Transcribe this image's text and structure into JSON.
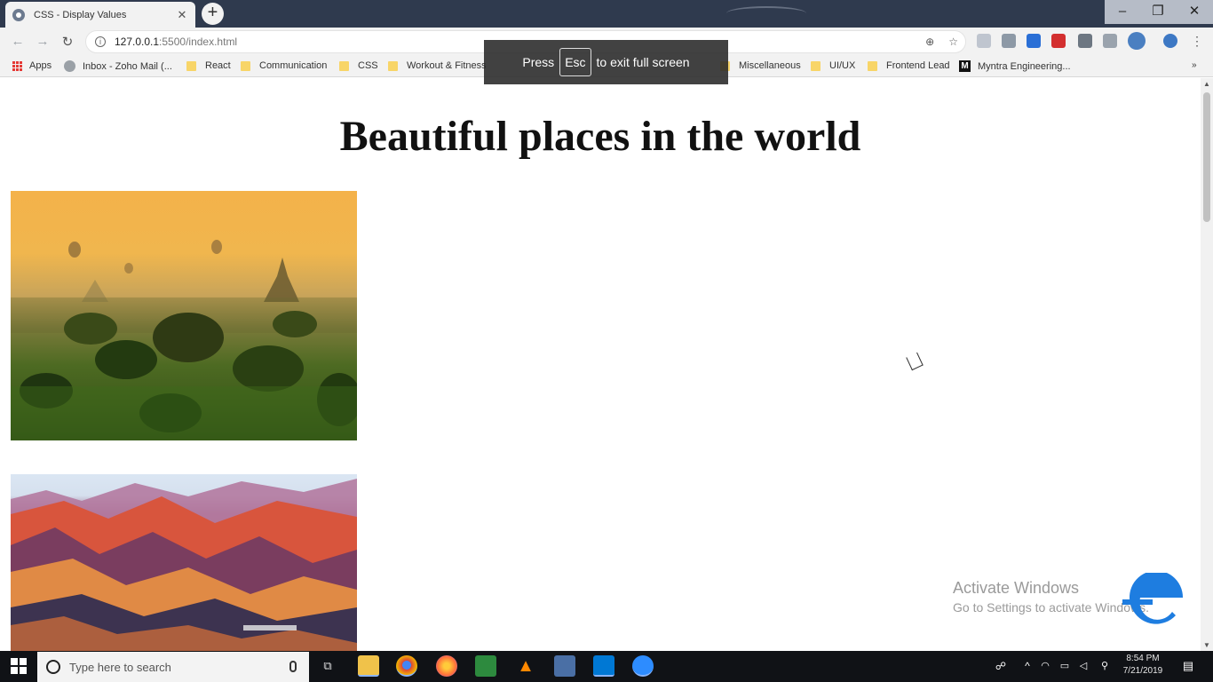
{
  "browser": {
    "tab_title": "CSS - Display Values",
    "tab_close": "✕",
    "new_tab": "+",
    "window_minimize": "–",
    "window_restore": "❐",
    "window_close": "✕",
    "nav_back": "←",
    "nav_forward": "→",
    "nav_reload": "↻",
    "url_host": "127.0.0.1",
    "url_path": ":5500/index.html",
    "info_icon": "i",
    "zoom_icon": "⊕",
    "star_icon": "☆"
  },
  "bookmarks": [
    {
      "label": "Apps",
      "type": "apps"
    },
    {
      "label": "Inbox - Zoho Mail (...",
      "type": "zoho"
    },
    {
      "label": "React",
      "type": "folder"
    },
    {
      "label": "Communication",
      "type": "folder"
    },
    {
      "label": "CSS",
      "type": "folder"
    },
    {
      "label": "Workout & Fitness",
      "type": "folder"
    },
    {
      "label": "Miscellaneous",
      "type": "folder"
    },
    {
      "label": "UI/UX",
      "type": "folder"
    },
    {
      "label": "Frontend Lead",
      "type": "folder"
    },
    {
      "label": "Myntra Engineering...",
      "type": "medium"
    }
  ],
  "bookmarks_overflow": "»",
  "fullscreen_notice": {
    "before": "Press",
    "key": "Esc",
    "after": "to exit full screen"
  },
  "page": {
    "heading": "Beautiful places in the world"
  },
  "watermark": {
    "title": "Activate Windows",
    "subtitle": "Go to Settings to activate Windows."
  },
  "taskbar": {
    "search_placeholder": "Type here to search",
    "time": "8:54 PM",
    "date": "7/21/2019"
  }
}
